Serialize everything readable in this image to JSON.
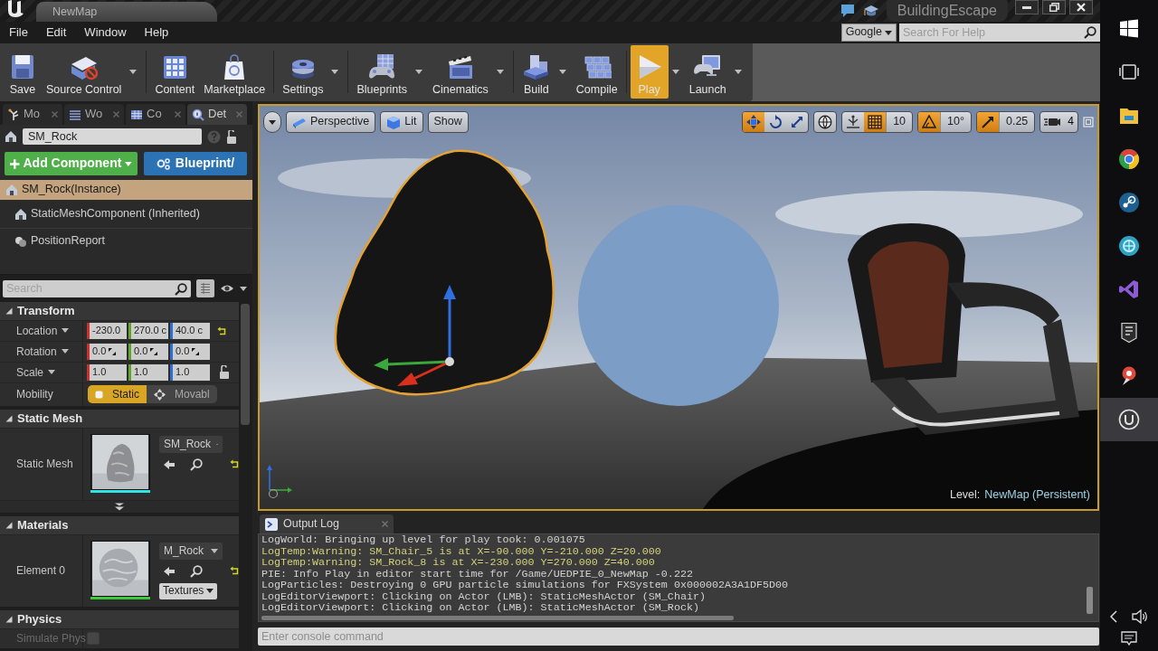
{
  "title_bar": {
    "tab": "NewMap",
    "project": "BuildingEscape"
  },
  "menu": [
    "File",
    "Edit",
    "Window",
    "Help"
  ],
  "help_search": {
    "engine": "Google",
    "placeholder": "Search For Help"
  },
  "toolbar": [
    [
      {
        "label": "Save",
        "kind": "save",
        "menu": false,
        "selected": false
      },
      {
        "label": "Source Control",
        "kind": "source",
        "menu": true,
        "selected": false
      }
    ],
    [
      {
        "label": "Content",
        "kind": "content",
        "menu": false,
        "selected": false
      },
      {
        "label": "Marketplace",
        "kind": "market",
        "menu": false,
        "selected": false
      }
    ],
    [
      {
        "label": "Settings",
        "kind": "settings",
        "menu": true,
        "selected": false
      }
    ],
    [
      {
        "label": "Blueprints",
        "kind": "blueprints",
        "menu": true,
        "selected": false
      },
      {
        "label": "Cinematics",
        "kind": "cinematics",
        "menu": true,
        "selected": false
      }
    ],
    [
      {
        "label": "Build",
        "kind": "build",
        "menu": true,
        "selected": false
      },
      {
        "label": "Compile",
        "kind": "compile",
        "menu": false,
        "selected": false
      }
    ],
    [
      {
        "label": "Play",
        "kind": "play",
        "menu": true,
        "selected": true
      },
      {
        "label": "Launch",
        "kind": "launch",
        "menu": true,
        "selected": false
      }
    ]
  ],
  "panel_tabs": [
    {
      "label": "Mo",
      "kind": "modes",
      "selected": false
    },
    {
      "label": "Wo",
      "kind": "outliner",
      "selected": false
    },
    {
      "label": "Co",
      "kind": "content",
      "selected": false
    },
    {
      "label": "Det",
      "kind": "details",
      "selected": true
    }
  ],
  "details": {
    "name": "SM_Rock",
    "add_button": "Add Component",
    "blueprint_button": "Blueprint/",
    "components": [
      {
        "label": "SM_Rock(Instance)",
        "kind": "actor",
        "selected": true,
        "children": [
          {
            "label": "StaticMeshComponent (Inherited)",
            "kind": "mesh",
            "selected": false
          },
          {
            "label": "PositionReport",
            "kind": "script",
            "selected": false
          }
        ]
      }
    ],
    "search": {
      "placeholder": "Search"
    },
    "sections": [
      {
        "title": "Transform",
        "expanded": true,
        "advanced": false,
        "rows": [
          {
            "label": "Location",
            "kind": "vector",
            "menu": true,
            "values": [
              "-230.0",
              "270.0 c",
              "40.0 c"
            ],
            "reset": true
          },
          {
            "label": "Rotation",
            "kind": "rotator",
            "menu": true,
            "values": [
              "0.0",
              "0.0",
              "0.0"
            ],
            "reset": false
          },
          {
            "label": "Scale",
            "kind": "vector",
            "menu": true,
            "values": [
              "1.0",
              "1.0",
              "1.0"
            ],
            "reset": false,
            "lock": {
              "locked": false
            }
          },
          {
            "label": "Mobility",
            "kind": "toggle",
            "options": [
              {
                "label": "Static",
                "kind": "static",
                "selected": true
              },
              {
                "label": "Movabl",
                "kind": "movable",
                "selected": false
              }
            ]
          }
        ]
      },
      {
        "title": "Static Mesh",
        "expanded": true,
        "advanced": true,
        "rows": [
          {
            "label": "Static Mesh",
            "kind": "asset",
            "asset": "SM_Rock",
            "thumbnail": {
              "kind": "rock",
              "color": "#2fe4e4"
            },
            "reset": true
          }
        ]
      },
      {
        "title": "Materials",
        "expanded": true,
        "advanced": false,
        "rows": [
          {
            "label": "Element 0",
            "kind": "asset",
            "asset": "M_Rock",
            "thumbnail": {
              "kind": "sphere",
              "color": "#3fc93f"
            },
            "button": "Textures",
            "reset": true
          }
        ]
      },
      {
        "title": "Physics",
        "expanded": true,
        "advanced": false,
        "rows": [
          {
            "label": "Simulate Phys",
            "kind": "checkbox",
            "checked": false,
            "disabled": true
          }
        ]
      }
    ]
  },
  "viewport": {
    "view_buttons": [
      {
        "label": "Perspective",
        "kind": "perspective"
      },
      {
        "label": "Lit",
        "kind": "lit"
      },
      {
        "label": "Show",
        "kind": "plain"
      }
    ],
    "transform_modes": [
      {
        "kind": "move",
        "selected": true
      },
      {
        "kind": "rotate",
        "selected": false
      },
      {
        "kind": "scale",
        "selected": false
      }
    ],
    "surface_snap": {
      "on": false
    },
    "snaps": [
      {
        "kind": "grid",
        "on": true,
        "value": "10"
      },
      {
        "kind": "rotation",
        "on": true,
        "value": "10°"
      },
      {
        "kind": "scale",
        "on": true,
        "value": "0.25"
      }
    ],
    "camera_speed": "4",
    "scene": [
      {
        "kind": "rock",
        "selected": true
      },
      {
        "kind": "sphere",
        "selected": false
      },
      {
        "kind": "chair",
        "selected": false
      }
    ],
    "level_label": "Level:",
    "level_name": "NewMap (Persistent)"
  },
  "output_log": {
    "tab": "Output Log",
    "lines": [
      {
        "text": "LogWorld: Bringing up level for play took: 0.001075",
        "kind": "info"
      },
      {
        "text": "LogTemp:Warning: SM_Chair_5 is at X=-90.000 Y=-210.000 Z=20.000",
        "kind": "warning"
      },
      {
        "text": "LogTemp:Warning: SM_Rock_8 is at X=-230.000 Y=270.000 Z=40.000",
        "kind": "warning"
      },
      {
        "text": "PIE: Info Play in editor start time for /Game/UEDPIE_0_NewMap -0.222",
        "kind": "info"
      },
      {
        "text": "LogParticles: Destroying 0 GPU particle simulations for FXSystem 0x000002A3A1DF5D00",
        "kind": "info"
      },
      {
        "text": "LogEditorViewport: Clicking on Actor (LMB): StaticMeshActor (SM_Chair)",
        "kind": "info"
      },
      {
        "text": "LogEditorViewport: Clicking on Actor (LMB): StaticMeshActor (SM_Rock)",
        "kind": "info"
      }
    ],
    "console_placeholder": "Enter console command"
  },
  "taskbar": {
    "apps": [
      {
        "kind": "start",
        "selected": false
      },
      {
        "kind": "tasks",
        "selected": false
      },
      {
        "kind": "folder",
        "selected": false
      },
      {
        "kind": "ring",
        "selected": false
      },
      {
        "kind": "disc",
        "selected": false
      },
      {
        "kind": "globe",
        "selected": false
      },
      {
        "kind": "ribbon",
        "selected": false
      },
      {
        "kind": "shield",
        "selected": false
      },
      {
        "kind": "pin",
        "selected": false
      },
      {
        "kind": "engine",
        "selected": true
      }
    ]
  }
}
